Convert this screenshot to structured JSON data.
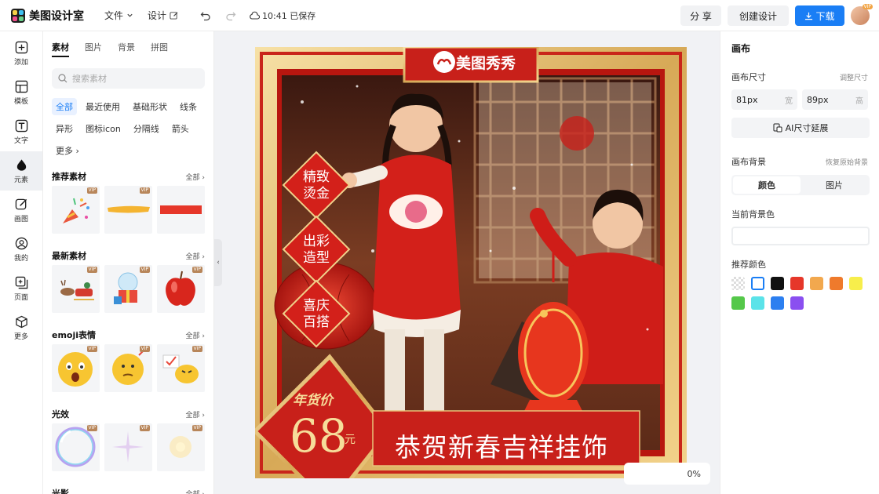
{
  "app": {
    "name": "美图设计室"
  },
  "topbar": {
    "file_label": "文件",
    "design_label": "设计",
    "saved_text": "10:41 已保存",
    "share_label": "分 享",
    "create_label": "创建设计",
    "download_label": "下载",
    "avatar_badge": "VIP"
  },
  "rail": [
    {
      "label": "添加",
      "icon": "plus-icon"
    },
    {
      "label": "模板",
      "icon": "template-icon"
    },
    {
      "label": "文字",
      "icon": "text-icon"
    },
    {
      "label": "元素",
      "icon": "shapes-icon"
    },
    {
      "label": "画图",
      "icon": "pen-icon"
    },
    {
      "label": "我的",
      "icon": "user-icon"
    },
    {
      "label": "页面",
      "icon": "page-icon"
    },
    {
      "label": "更多",
      "icon": "cube-icon"
    }
  ],
  "panel": {
    "tabs": [
      "素材",
      "图片",
      "背景",
      "拼图"
    ],
    "search_placeholder": "搜索素材",
    "chips": [
      "全部",
      "最近使用",
      "基础形状",
      "线条",
      "异形",
      "图标icon",
      "分隔线",
      "箭头",
      "更多"
    ],
    "all_label": "全部",
    "vip_label": "VIP",
    "sections": [
      "推荐素材",
      "最新素材",
      "emoji表情",
      "光效",
      "光影"
    ]
  },
  "poster": {
    "brand": "美图秀秀",
    "badge1": [
      "精致",
      "烫金"
    ],
    "badge2": [
      "出彩",
      "造型"
    ],
    "badge3": [
      "喜庆",
      "百搭"
    ],
    "price_tag": "年货价",
    "price": "68",
    "price_unit": "元",
    "headline": "恭贺新春吉祥挂饰"
  },
  "right_panel": {
    "title": "画布",
    "size_label": "画布尺寸",
    "adjust_size": "调整尺寸",
    "width_value": "81px",
    "width_unit": "宽",
    "height_value": "89px",
    "height_unit": "高",
    "ai_expand": "AI尺寸延展",
    "bg_label": "画布背景",
    "restore_bg": "恢复原始背景",
    "seg_color": "颜色",
    "seg_image": "图片",
    "current_bg": "当前背景色",
    "recommended": "推荐颜色",
    "colors": [
      "transparent",
      "#ffffff",
      "#111111",
      "#e6372a",
      "#f2a84e",
      "#ef7a2c",
      "#f7ee4b",
      "#55c84a",
      "#5be3e9",
      "#2c7ff0",
      "#8a4ff0"
    ]
  },
  "zoom": {
    "value": "0%"
  }
}
